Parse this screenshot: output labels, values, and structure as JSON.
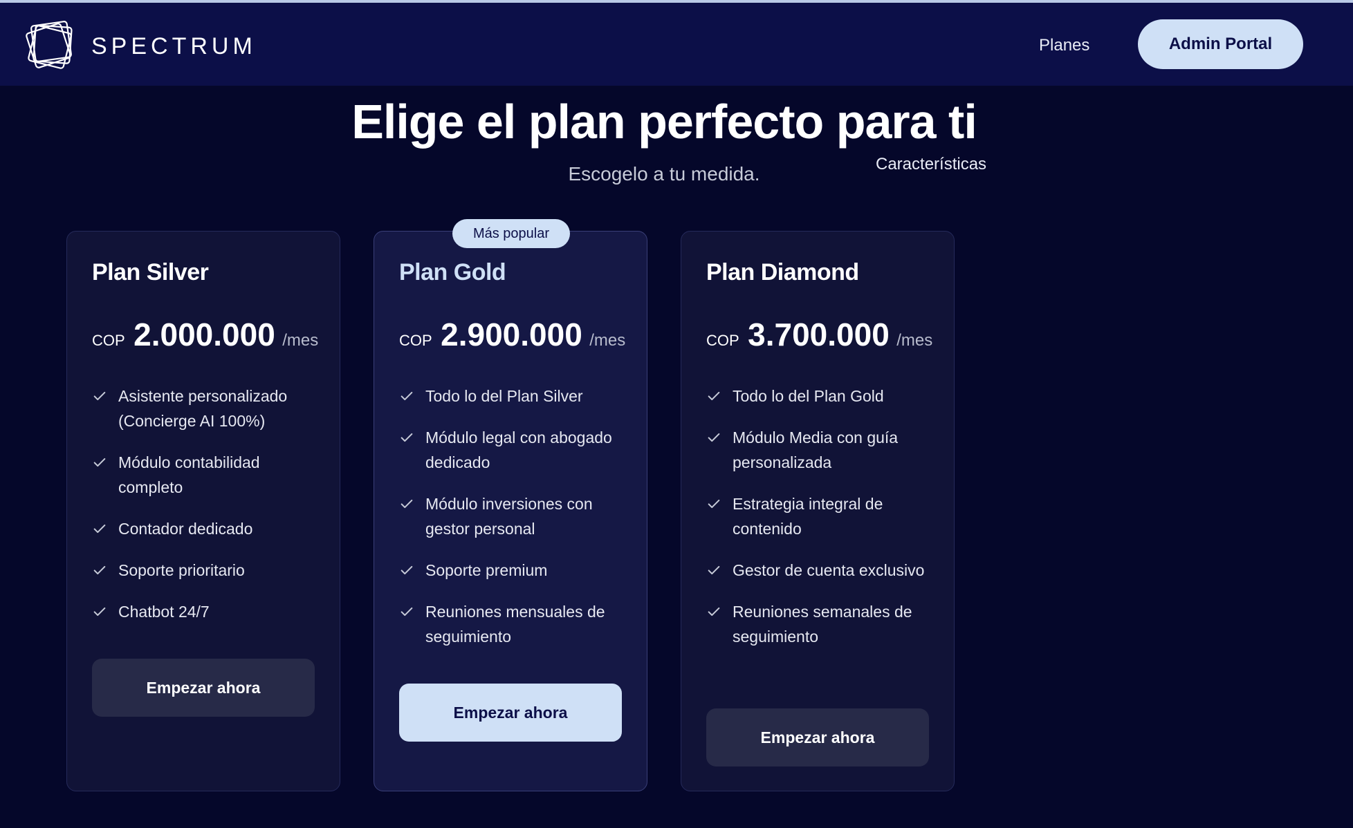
{
  "brand": {
    "name": "SPECTRUM",
    "logo_icon": "spectrum-logo-icon"
  },
  "nav": {
    "links": [
      "Características",
      "Planes"
    ],
    "admin_button": "Admin Portal"
  },
  "hero": {
    "title": "Elige el plan perfecto para ti",
    "subtitle": "Escogelo a tu medida."
  },
  "colors": {
    "background": "#05072a",
    "navbar": "#0c0f48",
    "accent": "#cfe0f6",
    "card": "#111337",
    "button_dark": "#272a48"
  },
  "plans": [
    {
      "name": "Plan Silver",
      "currency": "COP",
      "price": "2.000.000",
      "period": "/mes",
      "features": [
        "Asistente personalizado (Concierge AI 100%)",
        "Módulo contabilidad completo",
        "Contador dedicado",
        "Soporte prioritario",
        "Chatbot 24/7"
      ],
      "cta": "Empezar ahora"
    },
    {
      "name": "Plan Gold",
      "badge": "Más popular",
      "currency": "COP",
      "price": "2.900.000",
      "period": "/mes",
      "features": [
        "Todo lo del Plan Silver",
        "Módulo legal con abogado dedicado",
        "Módulo inversiones con gestor personal",
        "Soporte premium",
        "Reuniones mensuales de seguimiento"
      ],
      "cta": "Empezar ahora"
    },
    {
      "name": "Plan Diamond",
      "currency": "COP",
      "price": "3.700.000",
      "period": "/mes",
      "features": [
        "Todo lo del Plan Gold",
        "Módulo Media con guía personalizada",
        "Estrategia integral de contenido",
        "Gestor de cuenta exclusivo",
        "Reuniones semanales de seguimiento"
      ],
      "cta": "Empezar ahora"
    }
  ]
}
